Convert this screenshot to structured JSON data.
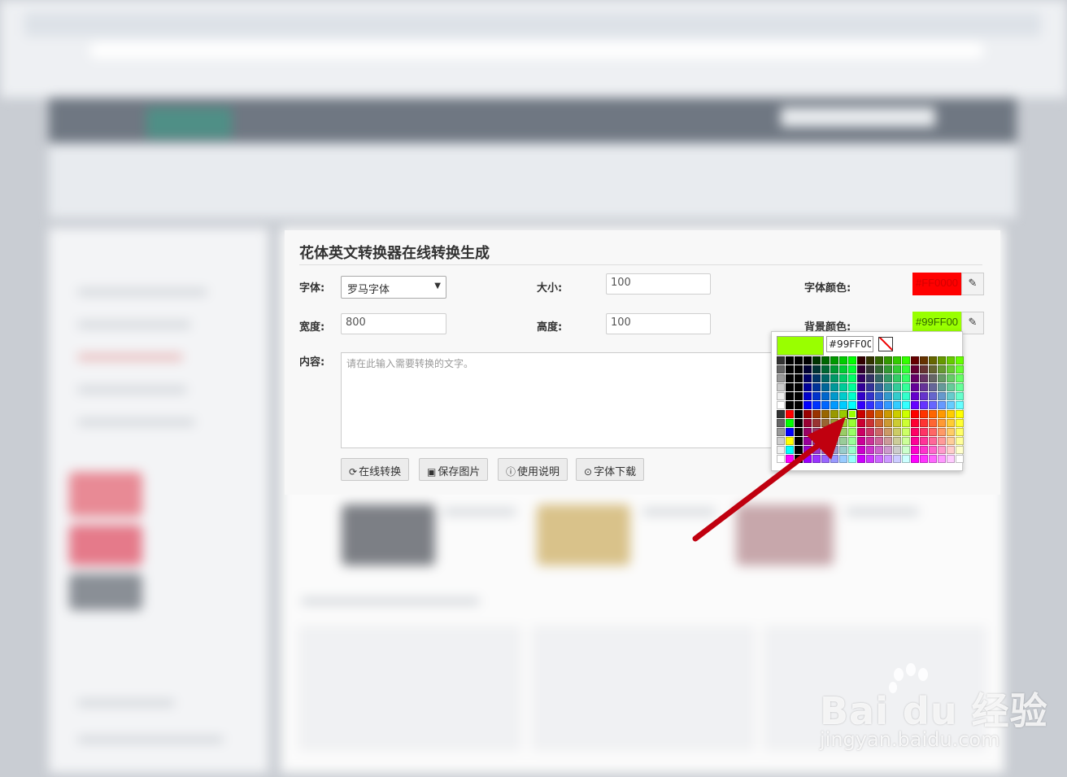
{
  "panel": {
    "title": "花体英文转换器在线转换生成",
    "font_label": "字体:",
    "font_value": "罗马字体",
    "size_label": "大小:",
    "size_value": "100",
    "font_color_label": "字体颜色:",
    "font_color_value": "#FF0000",
    "width_label": "宽度:",
    "width_value": "800",
    "height_label": "高度:",
    "height_value": "100",
    "bg_color_label": "背景颜色:",
    "bg_color_value": "#99FF00",
    "content_label": "内容:",
    "content_placeholder": "请在此输入需要转换的文字。",
    "buttons": {
      "convert": "在线转换",
      "save": "保存图片",
      "help": "使用说明",
      "download": "字体下载"
    }
  },
  "picker": {
    "hex_value": "#99FF00",
    "current_color": "#99ff00"
  },
  "colors": {
    "font_color": "#ff0000",
    "bg_color": "#99ff00",
    "arrow": "#c0000f"
  },
  "watermark": {
    "main": "Bai du 经验",
    "sub": "jingyan.baidu.com"
  }
}
